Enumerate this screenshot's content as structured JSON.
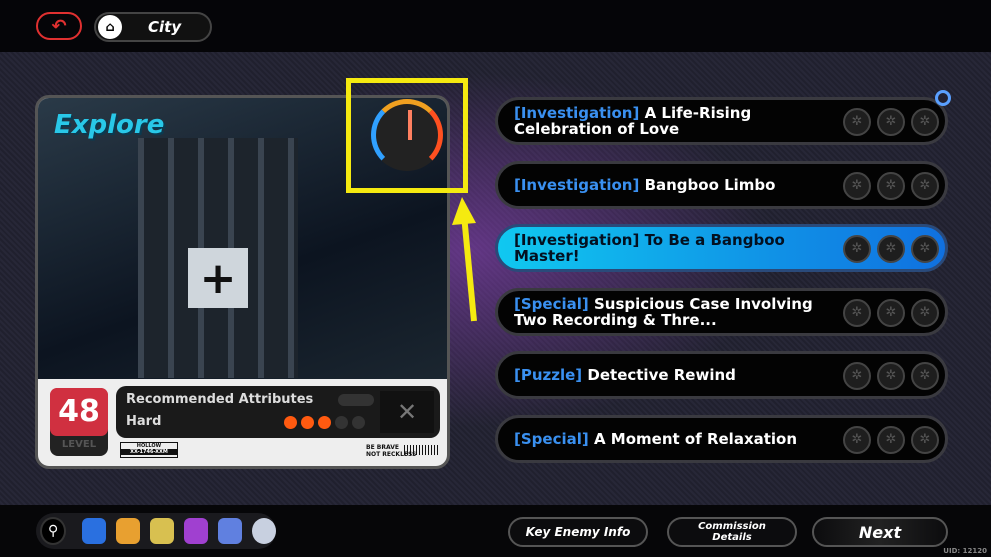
{
  "header": {
    "back_icon": "undo-arrow-icon",
    "home_icon": "home-icon",
    "location": "City"
  },
  "card": {
    "logo": "Explore",
    "level": "48",
    "level_label": "LEVEL",
    "recommended_label": "Recommended Attributes",
    "difficulty": "Hard",
    "difficulty_level": 3,
    "difficulty_max": 5,
    "tag_top": "HOLLOW",
    "tag_bottom": "XX-1746-XXM",
    "brave_top": "BE BRAVE",
    "brave_bottom": "NOT RECKLESS"
  },
  "annotation": {
    "highlight_color": "#f5ea10",
    "target": "gauge-icon"
  },
  "commissions": [
    {
      "category": "[Investigation]",
      "title": "A Life-Rising Celebration of Love",
      "selected": false,
      "pin": true
    },
    {
      "category": "[Investigation]",
      "title": "Bangboo Limbo",
      "selected": false
    },
    {
      "category": "[Investigation]",
      "title": "To Be a Bangboo Master!",
      "selected": true
    },
    {
      "category": "[Special]",
      "title": "Suspicious Case Involving Two Recording & Thre...",
      "selected": false
    },
    {
      "category": "[Puzzle]",
      "title": "Detective Rewind",
      "selected": false
    },
    {
      "category": "[Special]",
      "title": "A Moment of Relaxation",
      "selected": false
    }
  ],
  "footer": {
    "key_enemy": "Key Enemy Info",
    "commission_details": "Commission Details",
    "next": "Next",
    "uid": "UID: 12120"
  },
  "colors": {
    "accent": "#3a90f0",
    "selected": "#10c8f0",
    "level": "#d03040",
    "difficulty": "#ff5a10"
  }
}
